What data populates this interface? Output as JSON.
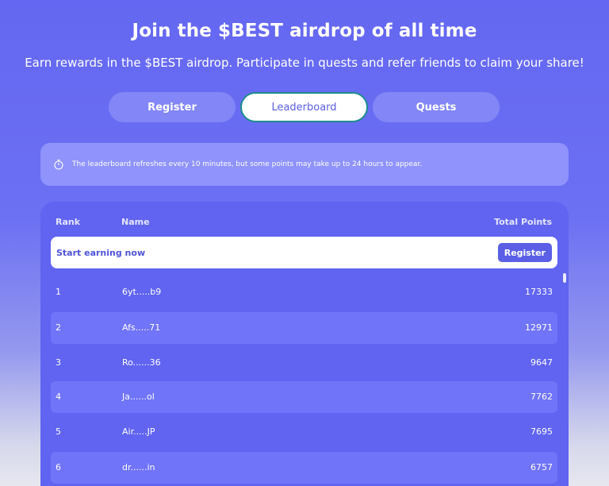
{
  "header": {
    "title": "Join the $BEST airdrop of all time",
    "subtitle": "Earn rewards in the $BEST airdrop. Participate in quests and refer friends to claim your share!"
  },
  "tabs": [
    {
      "label": "Register"
    },
    {
      "label": "Leaderboard",
      "active": true
    },
    {
      "label": "Quests"
    }
  ],
  "notice": {
    "icon": "stopwatch-icon",
    "text": "The leaderboard refreshes every 10 minutes, but some points may take up to 24 hours to appear."
  },
  "leaderboard": {
    "columns": {
      "rank": "Rank",
      "name": "Name",
      "points": "Total Points"
    },
    "cta": {
      "label": "Start earning now",
      "button": "Register"
    },
    "rows": [
      {
        "rank": "1",
        "name": "6yt.....b9",
        "points": "17333"
      },
      {
        "rank": "2",
        "name": "Afs.....71",
        "points": "12971"
      },
      {
        "rank": "3",
        "name": "Ro......36",
        "points": "9647"
      },
      {
        "rank": "4",
        "name": "Ja......ol",
        "points": "7762"
      },
      {
        "rank": "5",
        "name": "Air.....JP",
        "points": "7695"
      },
      {
        "rank": "6",
        "name": "dr......in",
        "points": "6757"
      }
    ]
  },
  "colors": {
    "accent": "#5a5fe6",
    "panel": "#6064f0",
    "row_alt": "#7074f8",
    "notice_bg": "#8f93fb",
    "active_tab_border": "#1f8d8b"
  }
}
